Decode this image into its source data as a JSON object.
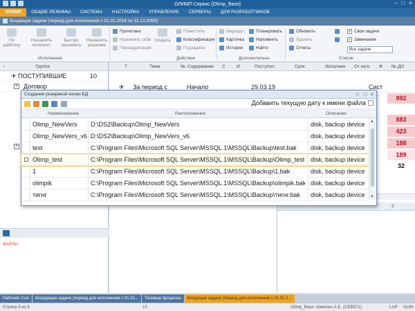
{
  "window": {
    "title": "ОЛИМП   Сервис [Olimp_Base]"
  },
  "menu": [
    "ОЛИМП",
    "ОБЩИЕ РЕЖИМЫ",
    "СИСТЕМА",
    "НАСТРОЙКА",
    "УПРАВЛЕНИЕ",
    "СЕРВЕРЫ",
    "ДЛЯ РАЗРАБОТЧИКОВ"
  ],
  "subtitle": "Входящие задачи (период для исполнения с 01.01.2018 по 31.12.2050)",
  "ribbon": {
    "big_buttons": [
      "По шаблону",
      "Назначить исполнит.",
      "Быстро назначить",
      "Назначить решение",
      "Создать"
    ],
    "group_ispolnenie": "Исполнение",
    "group_action": "Действие",
    "group_additional": "Дополнительно",
    "group_list": "Список",
    "small": {
      "read": "Прочитано",
      "assign_self": "Назначить себе",
      "readdress": "Переадресация",
      "move": "Поместить",
      "classify": "Классификация",
      "subtasks": "Подзадачи",
      "route": "Маршрут",
      "card": "Карточка",
      "history": "История",
      "plan": "Планировать",
      "remind": "Напомнить",
      "find": "Найти",
      "refresh": "Обновить",
      "delete": "Удалить",
      "reports": "Отчеты"
    },
    "checks": {
      "own_tasks": "Свои задачи",
      "reminders": "Замечания"
    },
    "select_value": "Все задачи"
  },
  "groups": {
    "header": "Группа",
    "rows": [
      {
        "label": "ПОСТУПИВШИЕ",
        "count": "10"
      },
      {
        "label": "Договор",
        "count": ""
      }
    ]
  },
  "files_label": "ФАЙЛЫ",
  "main_grid": {
    "headers": [
      "Тема",
      "№",
      "Содержание",
      "С",
      "И",
      "Поступил",
      "Срок",
      "Исполнен",
      "От кого",
      "Ф",
      "№ ДО"
    ],
    "row1": {
      "theme": "За период с",
      "content": "Начало",
      "received": "29.03.19",
      "from": "Сист"
    },
    "badges": [
      "992",
      "883",
      "423",
      "188",
      "189",
      "32"
    ],
    "lower_col": "3"
  },
  "dialog": {
    "title": "Создание резервной копии БД",
    "add_date_label": "Добавить текущую дату к имени файла",
    "headers": {
      "name": "Наименование",
      "location": "Расположение",
      "description": "Описание"
    },
    "rows": [
      {
        "name": "Olimp_NewVers",
        "path": "D:\\DS2\\Backup\\Olimp_NewVers",
        "desc": "disk, backup device"
      },
      {
        "name": "Olimp_NewVers_v6",
        "path": "D:\\DS2\\Backup\\Olimp_NewVers_v6",
        "desc": "disk, backup device"
      },
      {
        "name": "test",
        "path": "C:\\Program Files\\Microsoft SQL Server\\MSSQL.1\\MSSQL\\Backup\\test.bak",
        "desc": "disk, backup device"
      },
      {
        "name": "Olimp_test",
        "path": "C:\\Program Files\\Microsoft SQL Server\\MSSQL.1\\MSSQL\\Backup\\Olimp_test.bak",
        "desc": "disk, backup device"
      },
      {
        "name": "1",
        "path": "C:\\Program Files\\Microsoft SQL Server\\MSSQL.1\\MSSQL\\Backup\\1.bak",
        "desc": "disk, backup device"
      },
      {
        "name": "olimpik",
        "path": "C:\\Program Files\\Microsoft SQL Server\\MSSQL.1\\MSSQL\\Backup\\olimpik.bak",
        "desc": "disk, backup device"
      },
      {
        "name": "тигнг",
        "path": "C:\\Program Files\\Microsoft SQL Server\\MSSQL.1\\MSSQL\\Backup\\тигнг.bak",
        "desc": "disk, backup device"
      }
    ]
  },
  "doc_tabs": [
    "Рабочий стол",
    "Исходящие задачи (период для исполнения с 01.01...",
    "Типовые процессы",
    "Входящие задачи (период для исполнения с 01.01.2..."
  ],
  "status": {
    "rows": "Строка 5 из 8",
    "count": "10",
    "user": "Olimp_Base: Шмелин А.Б. (СЕВ571)",
    "lang": "LAP",
    "caps": "NUM"
  },
  "colors": {
    "accent": "#f2a21a",
    "header_blue": "#2a6aa6",
    "badge_red": "#f7c9cf"
  }
}
